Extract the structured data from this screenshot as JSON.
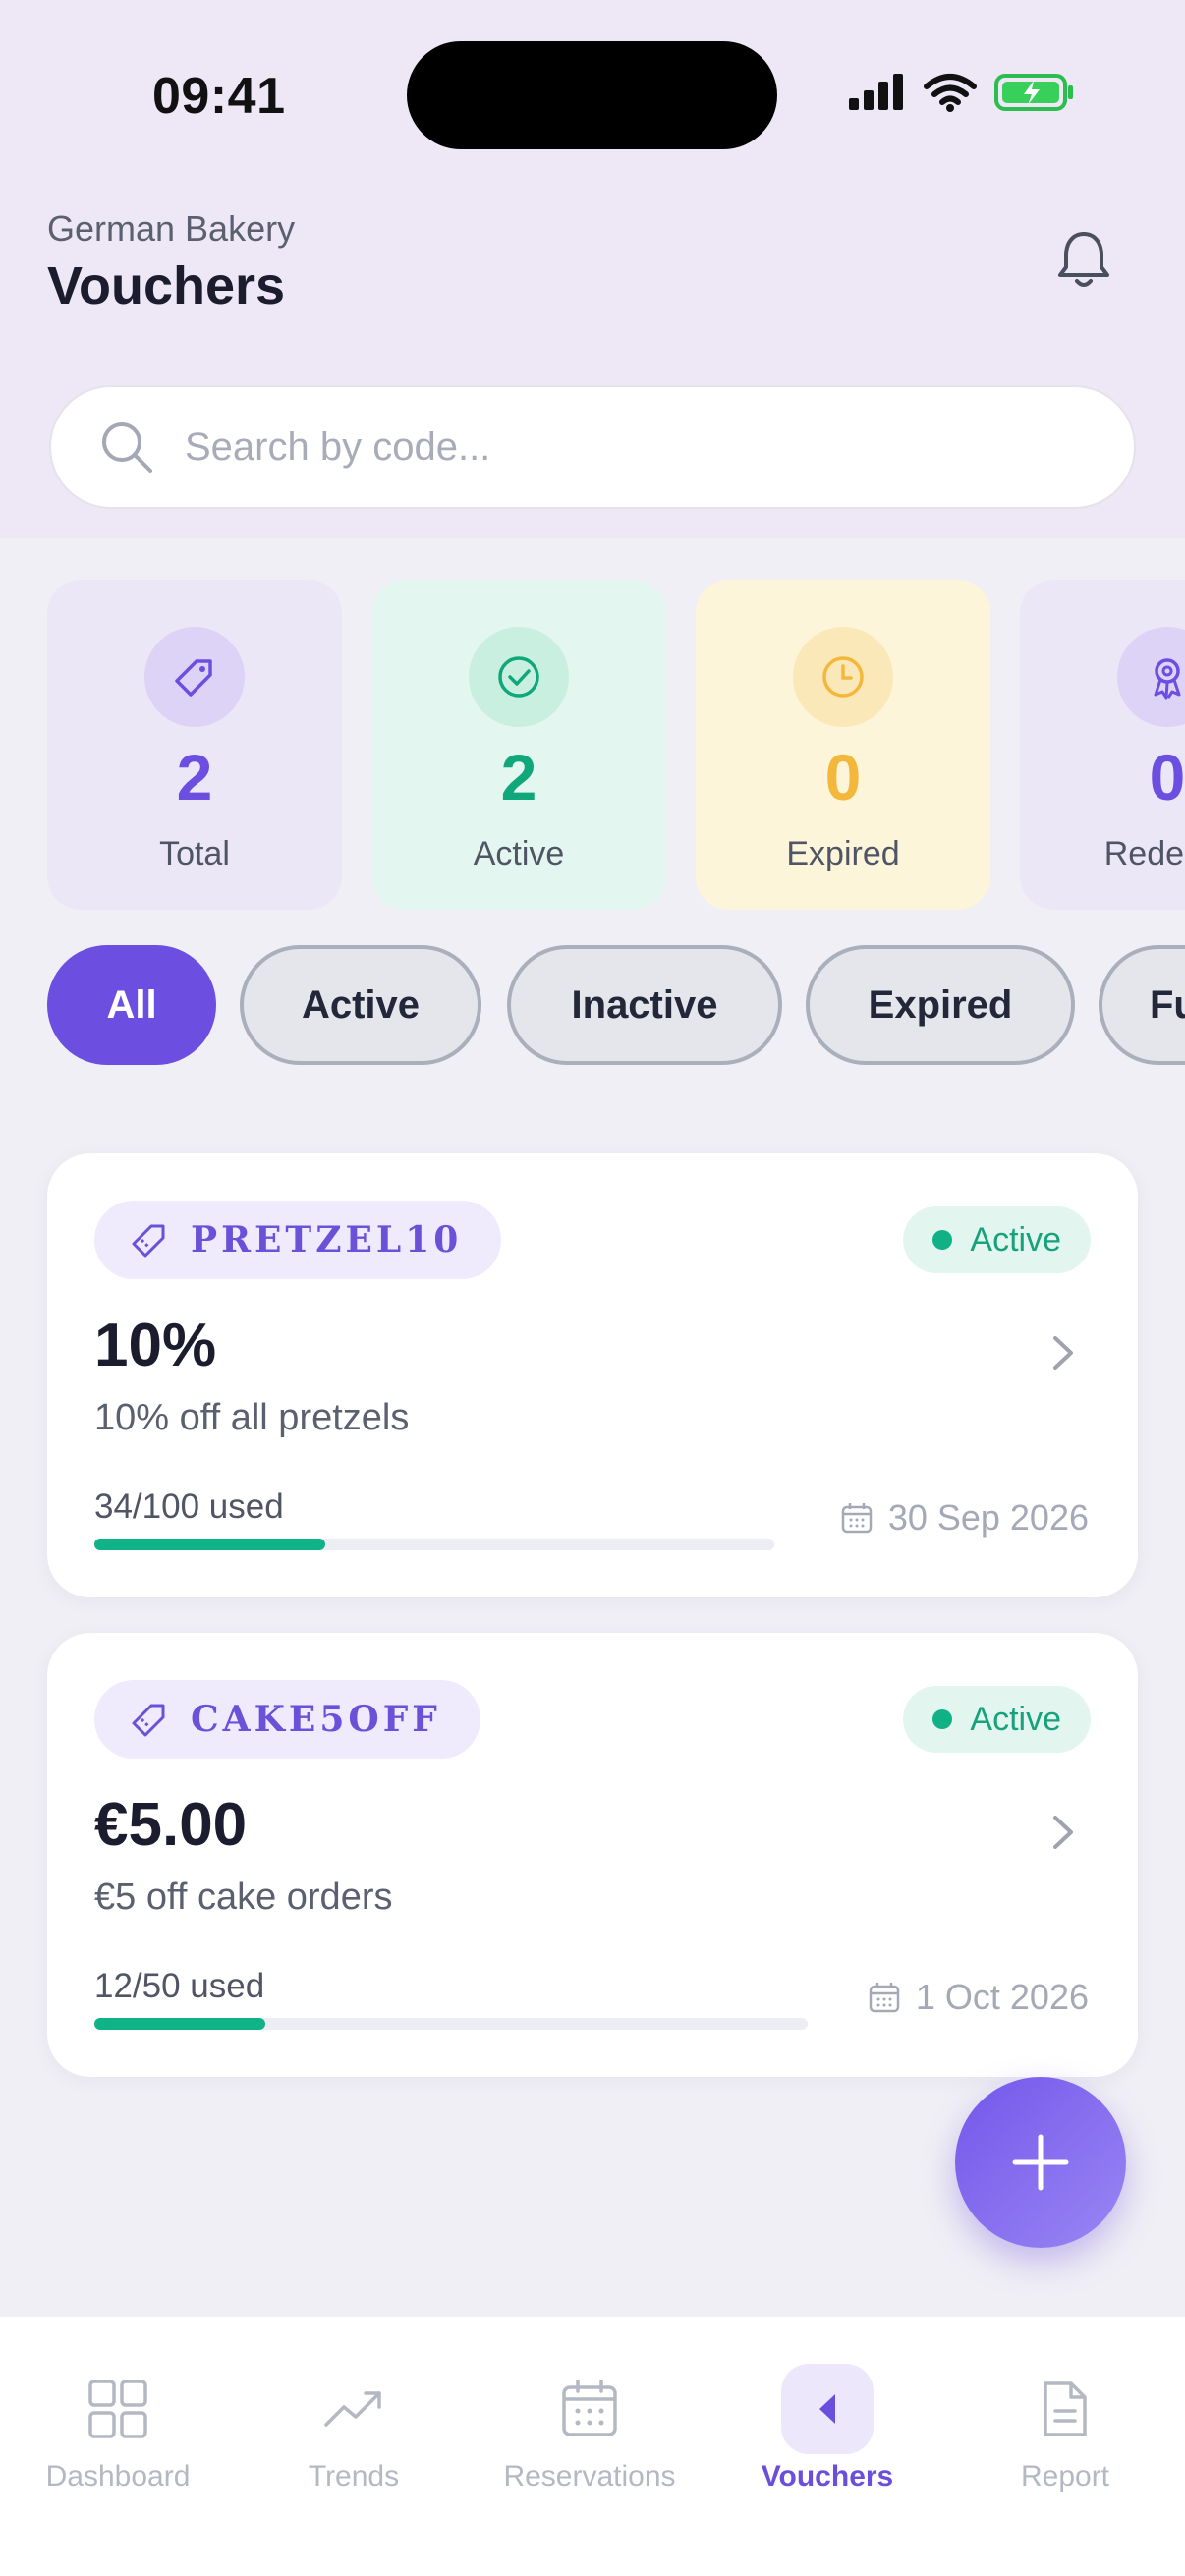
{
  "status_bar": {
    "time": "09:41"
  },
  "header": {
    "subtitle": "German Bakery",
    "title": "Vouchers"
  },
  "search": {
    "placeholder": "Search by code..."
  },
  "stats": [
    {
      "value": "2",
      "label": "Total",
      "icon": "tag-icon",
      "color": "#6c4fe0"
    },
    {
      "value": "2",
      "label": "Active",
      "icon": "check-circle-icon",
      "color": "#10a77a"
    },
    {
      "value": "0",
      "label": "Expired",
      "icon": "clock-icon",
      "color": "#f3b73b"
    },
    {
      "value": "0",
      "label": "Redeem",
      "icon": "award-icon",
      "color": "#6c4fe0"
    }
  ],
  "filters": [
    "All",
    "Active",
    "Inactive",
    "Expired",
    "Fu"
  ],
  "selected_filter": "All",
  "vouchers": [
    {
      "code": "PRETZEL10",
      "status": "Active",
      "amount": "10%",
      "description": "10% off all pretzels",
      "used_text": "34/100 used",
      "used_fraction": 0.34,
      "expiry": "30 Sep 2026"
    },
    {
      "code": "CAKE5OFF",
      "status": "Active",
      "amount": "€5.00",
      "description": "€5 off cake orders",
      "used_text": "12/50 used",
      "used_fraction": 0.24,
      "expiry": "1 Oct 2026"
    }
  ],
  "tabbar": {
    "items": [
      "Dashboard",
      "Trends",
      "Reservations",
      "Vouchers",
      "Report"
    ],
    "active": "Vouchers"
  },
  "colors": {
    "accent": "#6c4fe0",
    "success": "#10b387",
    "warning": "#f3b73b"
  }
}
